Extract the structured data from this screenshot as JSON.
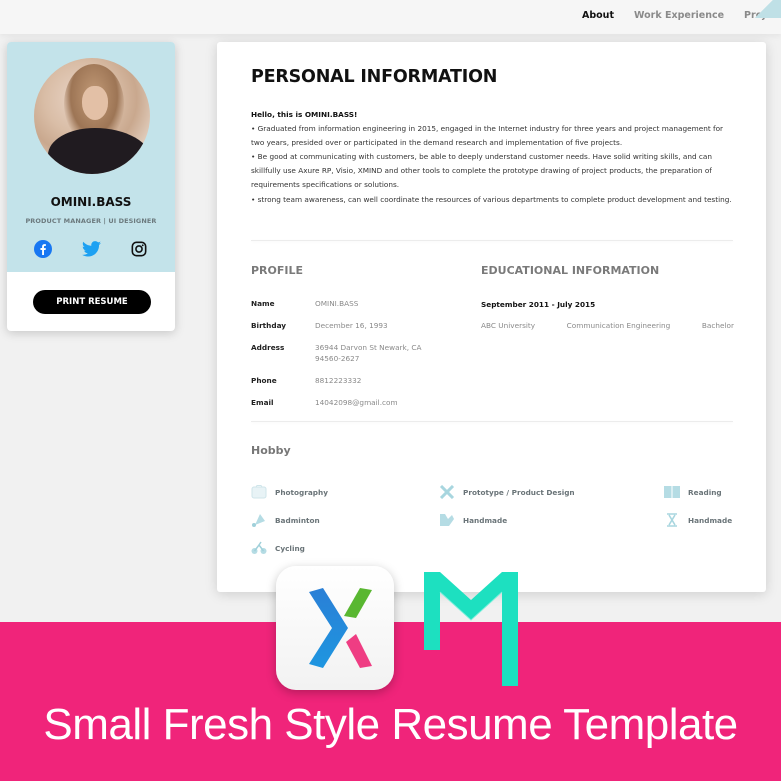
{
  "nav": {
    "items": [
      {
        "label": "About",
        "active": true
      },
      {
        "label": "Work Experience",
        "active": false
      },
      {
        "label": "Project Exp",
        "active": false
      }
    ]
  },
  "profile_card": {
    "name": "OMINI.BASS",
    "role": "PRODUCT MANAGER | UI DESIGNER",
    "socials": [
      "facebook-icon",
      "twitter-icon",
      "instagram-icon"
    ],
    "print_label": "PRINT RESUME",
    "colors": {
      "card_top": "#c3e3ea",
      "facebook": "#1877f2",
      "twitter": "#1da1f2"
    }
  },
  "resume": {
    "title": "PERSONAL INFORMATION",
    "intro": {
      "hello": "Hello, this is OMINI.BASS!",
      "bullets": [
        "• Graduated from information engineering in 2015, engaged in the Internet industry for three years and project management for two years, presided over or participated in the demand research and implementation of five projects.",
        "• Be good at communicating with customers, be able to deeply understand customer needs. Have solid writing skills, and can skillfully use Axure RP, Visio, XMIND and other tools to complete the prototype drawing of project products, the preparation of requirements specifications or solutions.",
        "• strong team awareness, can well coordinate the resources of various departments to complete product development and testing."
      ]
    },
    "profile": {
      "heading": "PROFILE",
      "rows": [
        {
          "label": "Name",
          "value": "OMINI.BASS"
        },
        {
          "label": "Birthday",
          "value": "December 16, 1993"
        },
        {
          "label": "Address",
          "value": "36944 Darvon St Newark, CA 94560-2627"
        },
        {
          "label": "Phone",
          "value": "8812223332"
        },
        {
          "label": "Email",
          "value": "14042098@gmail.com"
        }
      ]
    },
    "education": {
      "heading": "EDUCATIONAL INFORMATION",
      "period": "September 2011 - July 2015",
      "school": "ABC University",
      "major": "Communication Engineering",
      "degree": "Bachelor"
    },
    "hobby": {
      "heading": "Hobby",
      "items": [
        {
          "label": "Photography",
          "icon": "camera-icon"
        },
        {
          "label": "Prototype / Product Design",
          "icon": "design-tools-icon"
        },
        {
          "label": "Reading",
          "icon": "book-icon"
        },
        {
          "label": "Badminton",
          "icon": "shuttlecock-icon"
        },
        {
          "label": "Handmade",
          "icon": "handmade-icon"
        },
        {
          "label": "Handmade",
          "icon": "hourglass-icon"
        },
        {
          "label": "Cycling",
          "icon": "bicycle-icon"
        }
      ]
    }
  },
  "banner": {
    "title": "Small Fresh Style Resume Template",
    "logos": [
      "axure-logo",
      "mockplus-logo"
    ],
    "colors": {
      "background": "#f0247a",
      "mockplus": "#1de0c0"
    }
  }
}
